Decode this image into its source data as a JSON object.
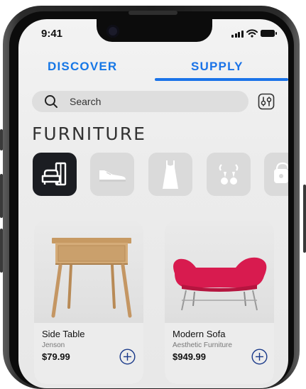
{
  "status_bar": {
    "time": "9:41"
  },
  "tabs": [
    {
      "label": "DISCOVER",
      "active": false
    },
    {
      "label": "SUPPLY",
      "active": true
    }
  ],
  "search": {
    "placeholder": "Search"
  },
  "page_title": "FURNITURE",
  "categories": [
    {
      "icon": "sofa-cabinet-icon",
      "active": true
    },
    {
      "icon": "sneaker-icon",
      "active": false
    },
    {
      "icon": "dress-icon",
      "active": false
    },
    {
      "icon": "earrings-icon",
      "active": false
    },
    {
      "icon": "handbag-icon",
      "active": false
    }
  ],
  "products": [
    {
      "name": "Side Table",
      "brand": "Jenson",
      "price": "$79.99"
    },
    {
      "name": "Modern Sofa",
      "brand": "Aesthetic Furniture",
      "price": "$949.99"
    }
  ],
  "colors": {
    "accent": "#1a73e8",
    "category_active": "#1b1d22",
    "sofa": "#d81b4f"
  }
}
